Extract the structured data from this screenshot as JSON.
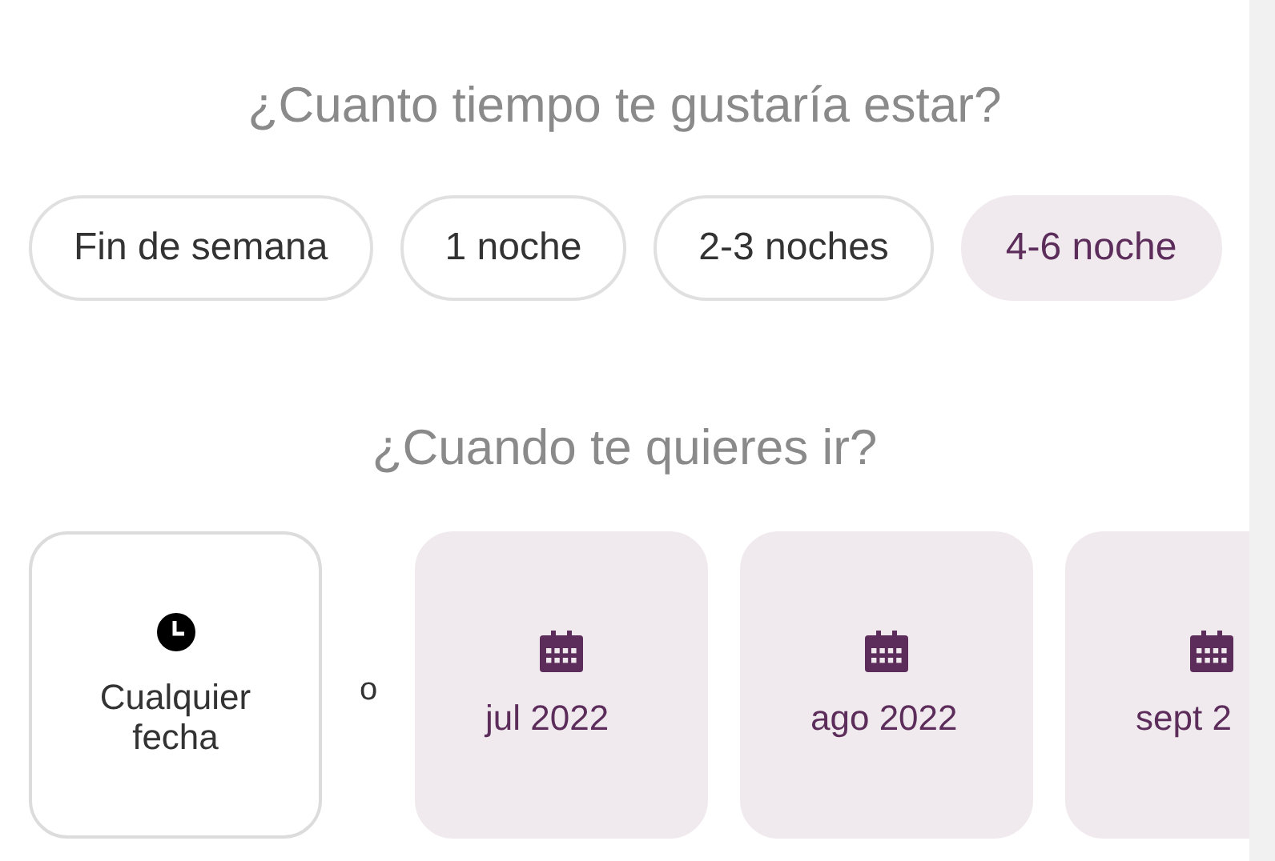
{
  "duration": {
    "title": "¿Cuanto tiempo te gustaría estar?",
    "options": [
      {
        "label": "Fin de semana",
        "selected": false
      },
      {
        "label": "1 noche",
        "selected": false
      },
      {
        "label": "2-3 noches",
        "selected": false
      },
      {
        "label": "4-6 noche",
        "selected": true
      }
    ]
  },
  "dates": {
    "title": "¿Cuando te quieres ir?",
    "separator": "o",
    "options": [
      {
        "kind": "any",
        "label": "Cualquier fecha"
      },
      {
        "kind": "month",
        "label": "jul 2022"
      },
      {
        "kind": "month",
        "label": "ago 2022"
      },
      {
        "kind": "month",
        "label": "sept 2"
      }
    ]
  }
}
